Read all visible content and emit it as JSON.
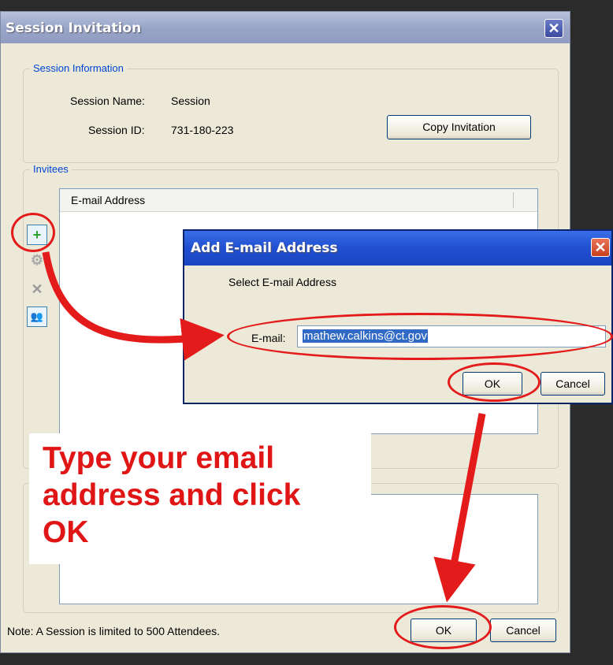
{
  "main_window": {
    "title": "Session Invitation",
    "session_info": {
      "legend": "Session Information",
      "name_label": "Session Name:",
      "name_value": "Session",
      "id_label": "Session ID:",
      "id_value": "731-180-223",
      "copy_button": "Copy Invitation"
    },
    "invitees": {
      "legend": "Invitees",
      "column_header": "E-mail Address"
    },
    "note": "Note: A Session is limited to 500 Attendees.",
    "ok_button": "OK",
    "cancel_button": "Cancel"
  },
  "add_email_dialog": {
    "title": "Add E-mail Address",
    "instruction": "Select E-mail Address",
    "email_label": "E-mail:",
    "email_value": "mathew.calkins@ct.gov",
    "ok_button": "OK",
    "cancel_button": "Cancel"
  },
  "annotation": {
    "line1": "Type your email",
    "line2": "address and click",
    "line3": "OK",
    "color": "#e01515"
  },
  "icons": {
    "add": "plus-icon",
    "settings": "gear-icon",
    "remove": "x-icon",
    "group": "people-icon"
  }
}
